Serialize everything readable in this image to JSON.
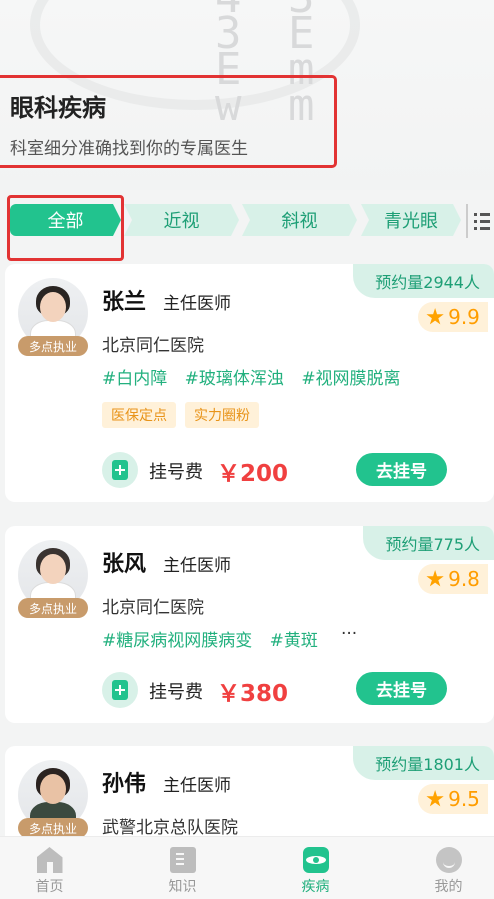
{
  "page": {
    "title": "眼科疾病",
    "subtitle": "科室细分准确找到你的专属医生"
  },
  "banner": {
    "eye_chart_rows": [
      "4 3",
      "3 E",
      "E m",
      "w m"
    ]
  },
  "tabs": [
    {
      "label": "全部",
      "active": true
    },
    {
      "label": "近视",
      "active": false
    },
    {
      "label": "斜视",
      "active": false
    },
    {
      "label": "青光眼",
      "active": false
    }
  ],
  "doctors": [
    {
      "name": "张兰",
      "title": "主任医师",
      "hospital": "北京同仁医院",
      "appointments": "预约量2944人",
      "rating": "9.9",
      "badge": "多点执业",
      "tags": [
        "#白内障",
        "#玻璃体浑浊",
        "#视网膜脱离"
      ],
      "labels": [
        "医保定点",
        "实力圈粉"
      ],
      "fee_label": "挂号费",
      "fee": "￥200",
      "book_label": "去挂号"
    },
    {
      "name": "张风",
      "title": "主任医师",
      "hospital": "北京同仁医院",
      "appointments": "预约量775人",
      "rating": "9.8",
      "badge": "多点执业",
      "tags": [
        "#糖尿病视网膜病变",
        "#黄斑"
      ],
      "more": "···",
      "fee_label": "挂号费",
      "fee": "￥380",
      "book_label": "去挂号"
    },
    {
      "name": "孙伟",
      "title": "主任医师",
      "hospital": "武警北京总队医院",
      "appointments": "预约量1801人",
      "rating": "9.5",
      "badge": "多点执业"
    }
  ],
  "nav": [
    {
      "label": "首页",
      "icon": "home-icon",
      "active": false
    },
    {
      "label": "知识",
      "icon": "knowledge-icon",
      "active": false
    },
    {
      "label": "疾病",
      "icon": "disease-icon",
      "active": true
    },
    {
      "label": "我的",
      "icon": "profile-icon",
      "active": false
    }
  ],
  "colors": {
    "accent": "#22c38e",
    "accent_light": "#d8f1e8",
    "price": "#f04040",
    "rating": "#ff9d00",
    "badge": "#c89b6b"
  }
}
